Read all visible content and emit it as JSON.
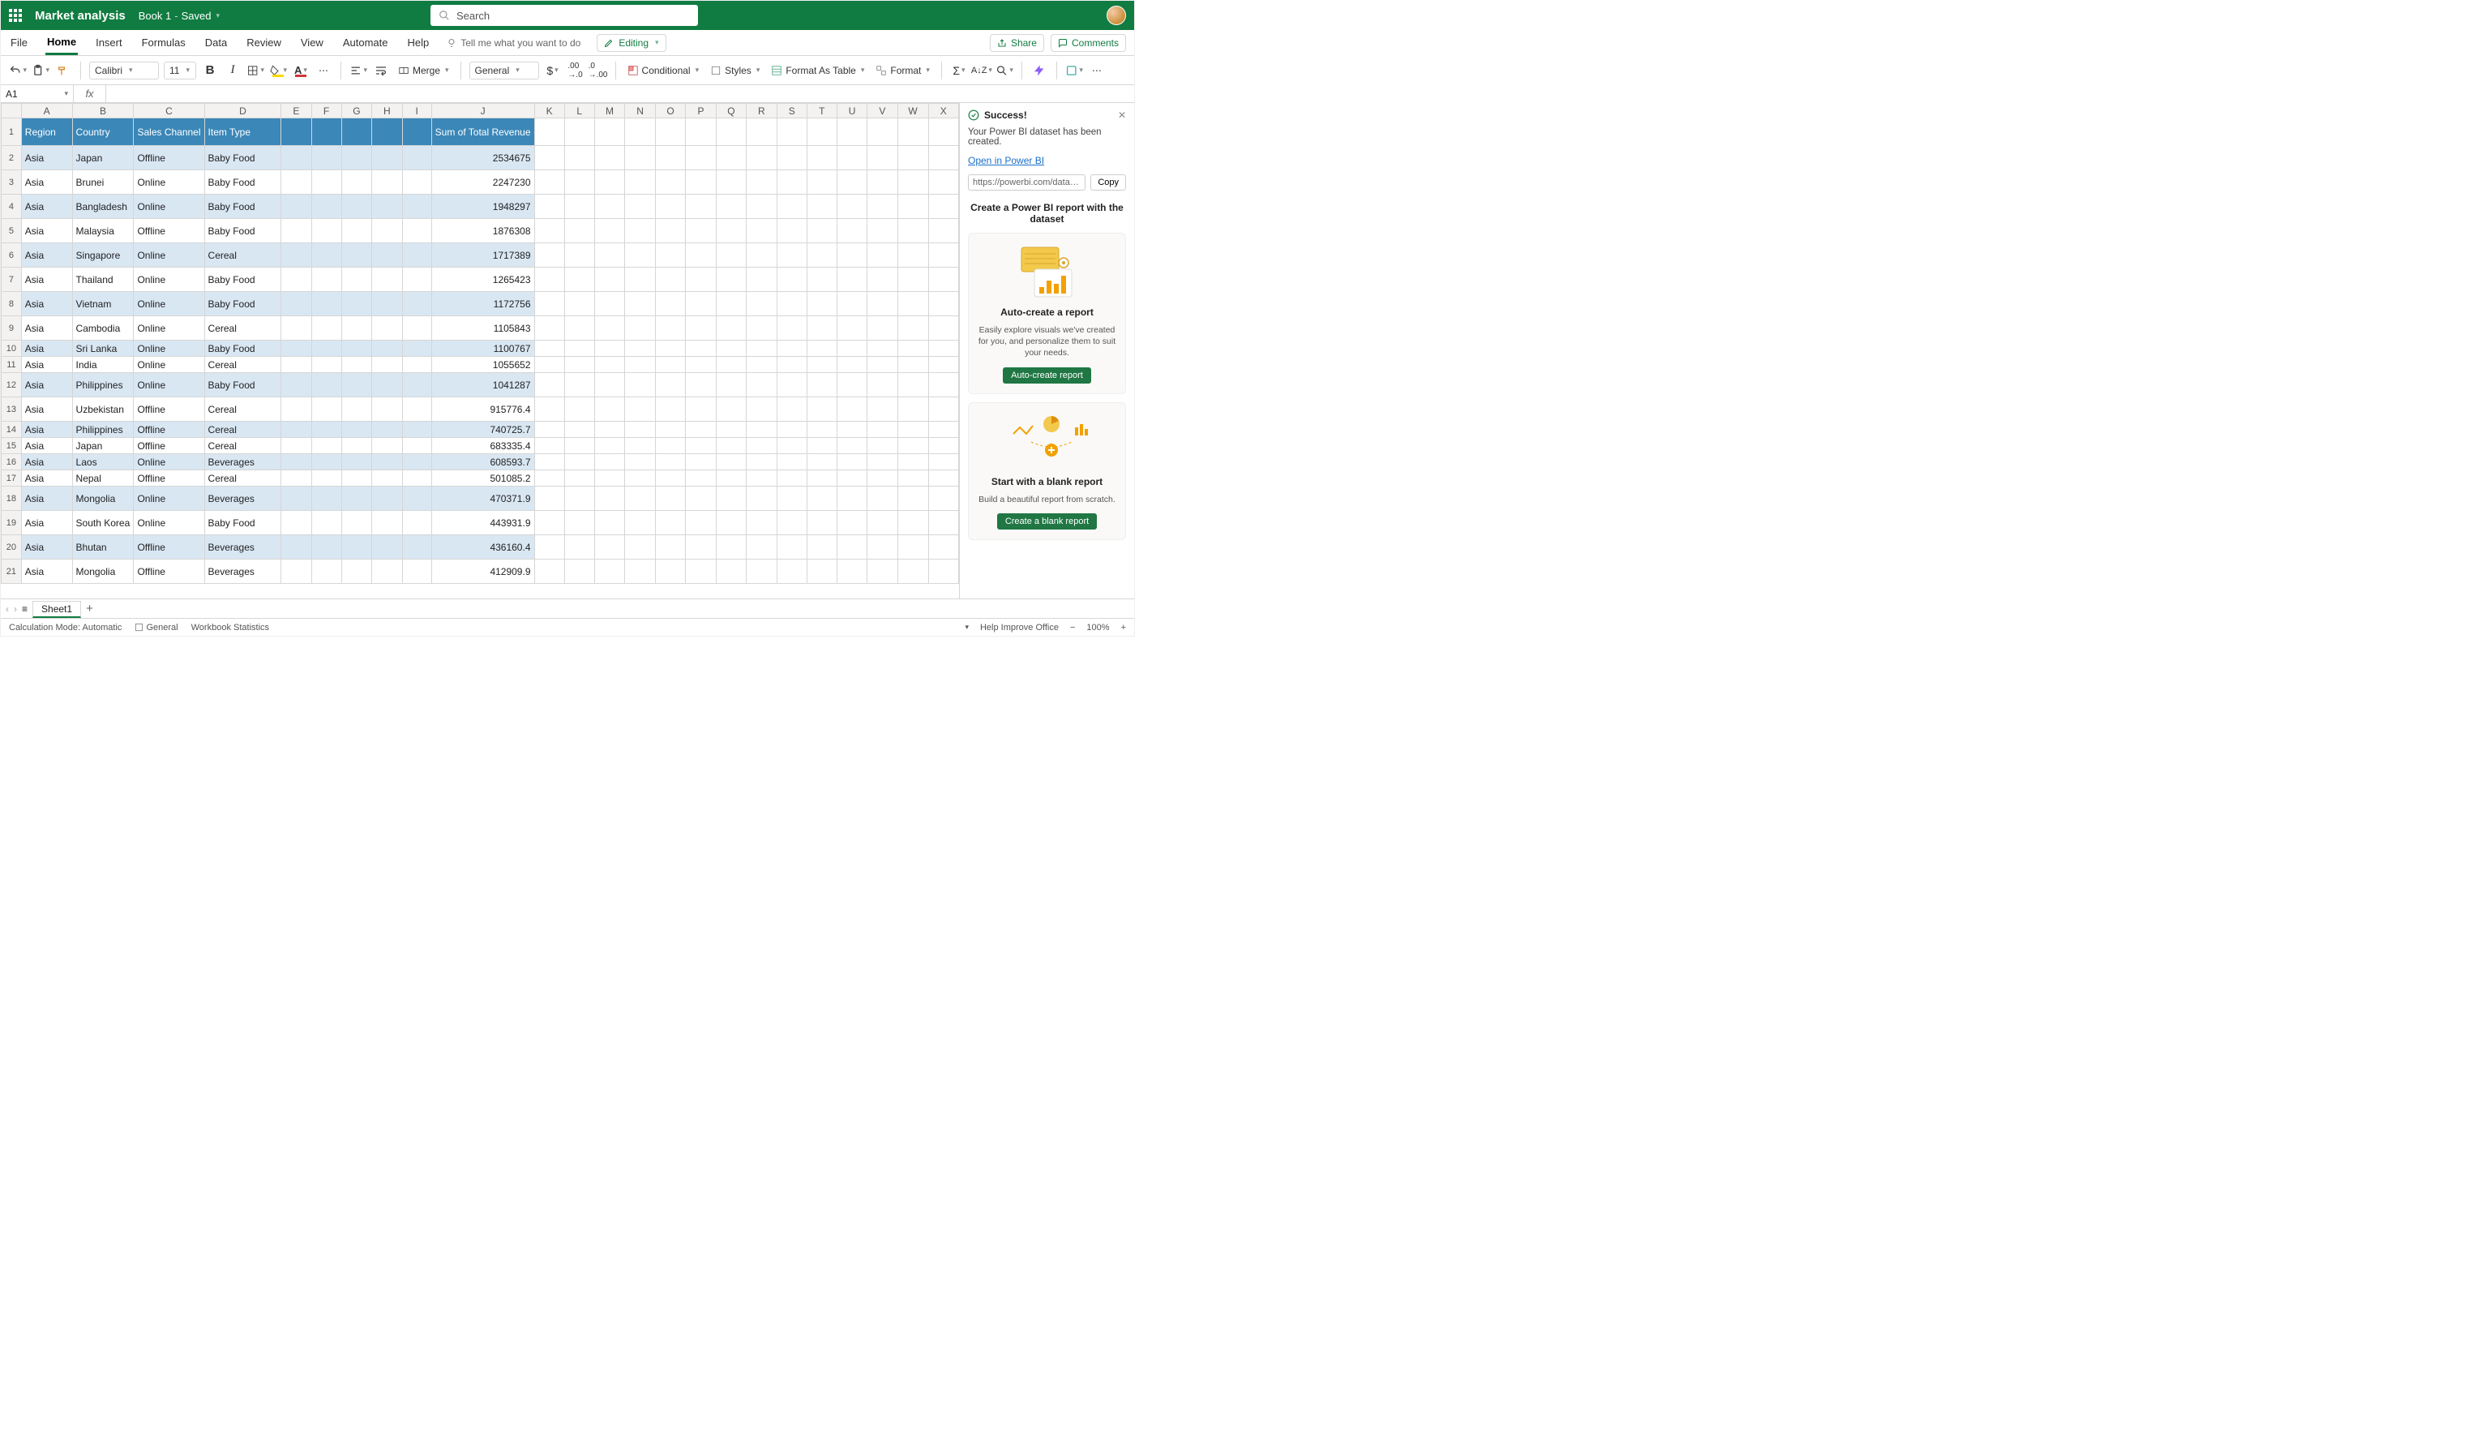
{
  "title": {
    "doc": "Market analysis",
    "book": "Book 1",
    "saved": "Saved"
  },
  "search": {
    "placeholder": "Search"
  },
  "tabs": {
    "file": "File",
    "home": "Home",
    "insert": "Insert",
    "formulas": "Formulas",
    "data": "Data",
    "review": "Review",
    "view": "View",
    "automate": "Automate",
    "help": "Help",
    "tellme": "Tell me what you want to do",
    "editing": "Editing",
    "share": "Share",
    "comments": "Comments"
  },
  "ribbon": {
    "font": "Calibri",
    "size": "11",
    "merge": "Merge",
    "numfmt": "General",
    "conditional": "Conditional",
    "styles": "Styles",
    "fat": "Format As Table",
    "format": "Format"
  },
  "fx": {
    "name": "A1"
  },
  "columns": [
    "A",
    "B",
    "C",
    "D",
    "E",
    "F",
    "G",
    "H",
    "I",
    "J",
    "K",
    "L",
    "M",
    "N",
    "O",
    "P",
    "Q",
    "R",
    "S",
    "T",
    "U",
    "V",
    "W",
    "X"
  ],
  "panel": {
    "title": "Success!",
    "msg": "Your Power BI dataset has been created.",
    "open": "Open in Power BI",
    "url": "https://powerbi.com/datahub/dat...",
    "copy": "Copy",
    "section": "Create a Power BI report with the dataset",
    "card1_title": "Auto-create a report",
    "card1_text": "Easily explore visuals we've created for you, and personalize them to suit your needs.",
    "card1_btn": "Auto-create report",
    "card2_title": "Start with a blank report",
    "card2_text": "Build a beautiful report from scratch.",
    "card2_btn": "Create a blank report"
  },
  "sheets": {
    "name": "Sheet1"
  },
  "status": {
    "calc": "Calculation Mode: Automatic",
    "general": "General",
    "wb": "Workbook Statistics",
    "help": "Help Improve Office",
    "zoom": "100%"
  },
  "headers": {
    "region": "Region",
    "country": "Country",
    "channel": "Sales Channel",
    "item": "Item Type",
    "revenue": "Sum of Total Revenue"
  },
  "rows": [
    {
      "n": 2,
      "h": true,
      "r": "Asia",
      "c": "Japan",
      "s": "Offline",
      "i": "Baby Food",
      "v": "2534675"
    },
    {
      "n": 3,
      "h": true,
      "r": "Asia",
      "c": "Brunei",
      "s": "Online",
      "i": "Baby Food",
      "v": "2247230"
    },
    {
      "n": 4,
      "h": true,
      "r": "Asia",
      "c": "Bangladesh",
      "s": "Online",
      "i": "Baby Food",
      "v": "1948297"
    },
    {
      "n": 5,
      "h": true,
      "r": "Asia",
      "c": "Malaysia",
      "s": "Offline",
      "i": "Baby Food",
      "v": "1876308"
    },
    {
      "n": 6,
      "h": true,
      "r": "Asia",
      "c": "Singapore",
      "s": "Online",
      "i": "Cereal",
      "v": "1717389"
    },
    {
      "n": 7,
      "h": true,
      "r": "Asia",
      "c": "Thailand",
      "s": "Online",
      "i": "Baby Food",
      "v": "1265423"
    },
    {
      "n": 8,
      "h": true,
      "r": "Asia",
      "c": "Vietnam",
      "s": "Online",
      "i": "Baby Food",
      "v": "1172756"
    },
    {
      "n": 9,
      "h": true,
      "r": "Asia",
      "c": "Cambodia",
      "s": "Online",
      "i": "Cereal",
      "v": "1105843"
    },
    {
      "n": 10,
      "h": false,
      "r": "Asia",
      "c": "Sri Lanka",
      "s": "Online",
      "i": "Baby Food",
      "v": "1100767"
    },
    {
      "n": 11,
      "h": false,
      "r": "Asia",
      "c": "India",
      "s": "Online",
      "i": "Cereal",
      "v": "1055652"
    },
    {
      "n": 12,
      "h": true,
      "r": "Asia",
      "c": "Philippines",
      "s": "Online",
      "i": "Baby Food",
      "v": "1041287"
    },
    {
      "n": 13,
      "h": true,
      "r": "Asia",
      "c": "Uzbekistan",
      "s": "Offline",
      "i": "Cereal",
      "v": "915776.4"
    },
    {
      "n": 14,
      "h": false,
      "r": "Asia",
      "c": "Philippines",
      "s": "Offline",
      "i": "Cereal",
      "v": "740725.7"
    },
    {
      "n": 15,
      "h": false,
      "r": "Asia",
      "c": "Japan",
      "s": "Offline",
      "i": "Cereal",
      "v": "683335.4"
    },
    {
      "n": 16,
      "h": false,
      "r": "Asia",
      "c": "Laos",
      "s": "Online",
      "i": "Beverages",
      "v": "608593.7"
    },
    {
      "n": 17,
      "h": false,
      "r": "Asia",
      "c": "Nepal",
      "s": "Offline",
      "i": "Cereal",
      "v": "501085.2"
    },
    {
      "n": 18,
      "h": true,
      "r": "Asia",
      "c": "Mongolia",
      "s": "Online",
      "i": "Beverages",
      "v": "470371.9"
    },
    {
      "n": 19,
      "h": true,
      "r": "Asia",
      "c": "South Korea",
      "s": "Online",
      "i": "Baby Food",
      "v": "443931.9"
    },
    {
      "n": 20,
      "h": true,
      "r": "Asia",
      "c": "Bhutan",
      "s": "Offline",
      "i": "Beverages",
      "v": "436160.4"
    },
    {
      "n": 21,
      "h": true,
      "r": "Asia",
      "c": "Mongolia",
      "s": "Offline",
      "i": "Beverages",
      "v": "412909.9"
    }
  ]
}
